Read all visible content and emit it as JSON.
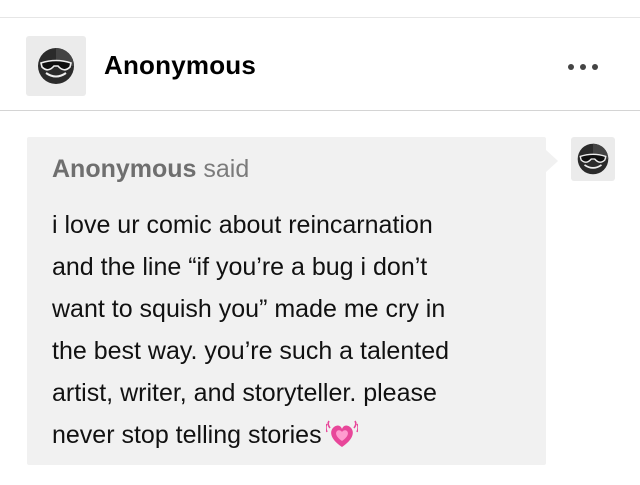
{
  "header": {
    "username": "Anonymous",
    "avatar_icon": "anonymous-sunglasses-icon",
    "more_icon": "more-options-icon"
  },
  "ask": {
    "asker_name": "Anonymous",
    "said_label": "said",
    "message_lines": [
      "i love ur comic about reincarnation",
      "and the line “if you’re a bug i don’t",
      "want to squish you” made me cry in",
      "the best way. you’re such a talented",
      "artist, writer, and storyteller. please",
      "never stop telling stories"
    ],
    "emoji_icon": "growing-heart-icon",
    "bubble_color": "#f1f1f1",
    "heart_color": "#e8479a"
  }
}
